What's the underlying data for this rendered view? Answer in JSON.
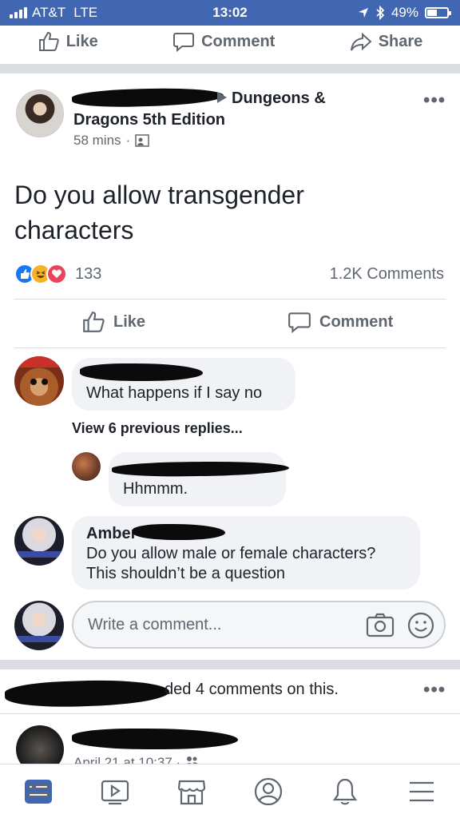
{
  "status_bar": {
    "carrier": "AT&T",
    "network": "LTE",
    "time": "13:02",
    "battery": "49%",
    "battery_level": 0.49,
    "icons": [
      "signal-icon",
      "location-arrow-icon",
      "bluetooth-icon",
      "battery-icon"
    ]
  },
  "prev_post_actions": {
    "like": "Like",
    "comment": "Comment",
    "share": "Share"
  },
  "post": {
    "group": "Dungeons & Dragons 5th Edition",
    "time": "58 mins",
    "separator": "·",
    "body": "Do you allow transgender characters",
    "reactions_count": "133",
    "comments_count": "1.2K Comments",
    "actions": {
      "like": "Like",
      "comment": "Comment"
    },
    "reaction_types": [
      "like",
      "haha",
      "love"
    ]
  },
  "comments": [
    {
      "author": "",
      "text": "What happens if I say no"
    },
    {
      "author": "",
      "text": "Hhmmm."
    },
    {
      "author": "Amber",
      "text": "Do you allow male or female characters? This shouldn’t be a question"
    }
  ],
  "view_replies": "View 6 previous replies...",
  "write_comment": {
    "placeholder": "Write a comment..."
  },
  "next_post": {
    "notice": "ded 4 comments on this.",
    "date": "April 21 at 10:37",
    "separator": "·"
  },
  "tabbar": {
    "items": [
      "news-feed",
      "watch",
      "marketplace",
      "profile",
      "notifications",
      "menu"
    ],
    "active": "news-feed",
    "accent": "#4267b2"
  },
  "colors": {
    "brand": "#4267b2",
    "text": "#1d2129",
    "secondary": "#606770",
    "bubble": "#f0f2f5"
  }
}
